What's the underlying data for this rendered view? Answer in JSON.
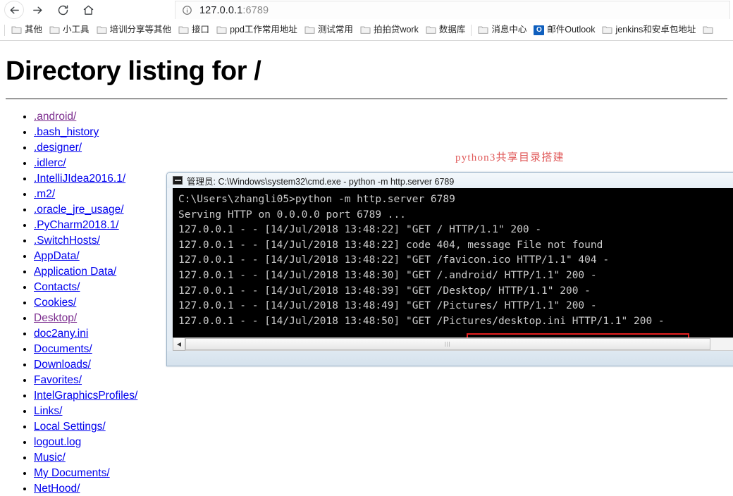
{
  "browser": {
    "nav": {
      "back_label": "Back",
      "forward_label": "Forward",
      "reload_label": "Reload",
      "home_label": "Home"
    },
    "omnibox": {
      "info_icon": "page-info-icon",
      "url_host": "127.0.0.1",
      "url_port": ":6789"
    },
    "bookmarks": [
      {
        "label": "其他",
        "icon": "folder-icon"
      },
      {
        "label": "小工具",
        "icon": "folder-icon"
      },
      {
        "label": "培训分享等其他",
        "icon": "folder-icon"
      },
      {
        "label": "接口",
        "icon": "folder-icon"
      },
      {
        "label": "ppd工作常用地址",
        "icon": "folder-icon"
      },
      {
        "label": "测试常用",
        "icon": "folder-icon"
      },
      {
        "label": "拍拍贷work",
        "icon": "folder-icon"
      },
      {
        "label": "数据库",
        "icon": "folder-icon"
      },
      {
        "label": "消息中心",
        "icon": "folder-icon"
      },
      {
        "label": "邮件Outlook",
        "icon": "outlook-icon",
        "icon_text": "O"
      },
      {
        "label": "jenkins和安卓包地址",
        "icon": "folder-icon"
      },
      {
        "label": "",
        "icon": "folder-icon"
      }
    ]
  },
  "page": {
    "title": "Directory listing for /",
    "entries": [
      {
        "name": ".android/",
        "visited": true
      },
      {
        "name": ".bash_history",
        "visited": false
      },
      {
        "name": ".designer/",
        "visited": false
      },
      {
        "name": ".idlerc/",
        "visited": false
      },
      {
        "name": ".IntelliJIdea2016.1/",
        "visited": false
      },
      {
        "name": ".m2/",
        "visited": false
      },
      {
        "name": ".oracle_jre_usage/",
        "visited": false
      },
      {
        "name": ".PyCharm2018.1/",
        "visited": false
      },
      {
        "name": ".SwitchHosts/",
        "visited": false
      },
      {
        "name": "AppData/",
        "visited": false
      },
      {
        "name": "Application Data/",
        "visited": false
      },
      {
        "name": "Contacts/",
        "visited": false
      },
      {
        "name": "Cookies/",
        "visited": false
      },
      {
        "name": "Desktop/",
        "visited": true
      },
      {
        "name": "doc2any.ini",
        "visited": false
      },
      {
        "name": "Documents/",
        "visited": false
      },
      {
        "name": "Downloads/",
        "visited": false
      },
      {
        "name": "Favorites/",
        "visited": false
      },
      {
        "name": "IntelGraphicsProfiles/",
        "visited": false
      },
      {
        "name": "Links/",
        "visited": false
      },
      {
        "name": "Local Settings/",
        "visited": false
      },
      {
        "name": "logout.log",
        "visited": false
      },
      {
        "name": "Music/",
        "visited": false
      },
      {
        "name": "My Documents/",
        "visited": false
      },
      {
        "name": "NetHood/",
        "visited": false
      }
    ]
  },
  "annotation": {
    "text": "python3共享目录搭建",
    "color": "#e05a5a"
  },
  "cmd_window": {
    "title": "管理员: C:\\Windows\\system32\\cmd.exe - python  -m http.server 6789",
    "icon": "console-icon",
    "highlight_color": "#e62020",
    "console_lines": [
      "C:\\Users\\zhangli05>python -m http.server 6789",
      "Serving HTTP on 0.0.0.0 port 6789 ...",
      "127.0.0.1 - - [14/Jul/2018 13:48:22] \"GET / HTTP/1.1\" 200 -",
      "127.0.0.1 - - [14/Jul/2018 13:48:22] code 404, message File not found",
      "127.0.0.1 - - [14/Jul/2018 13:48:22] \"GET /favicon.ico HTTP/1.1\" 404 -",
      "127.0.0.1 - - [14/Jul/2018 13:48:30] \"GET /.android/ HTTP/1.1\" 200 -",
      "127.0.0.1 - - [14/Jul/2018 13:48:39] \"GET /Desktop/ HTTP/1.1\" 200 -",
      "127.0.0.1 - - [14/Jul/2018 13:48:49] \"GET /Pictures/ HTTP/1.1\" 200 -",
      "127.0.0.1 - - [14/Jul/2018 13:48:50] \"GET /Pictures/desktop.ini HTTP/1.1\" 200 -"
    ],
    "scroll_left_arrow": "◀",
    "scroll_grip": "|||"
  }
}
